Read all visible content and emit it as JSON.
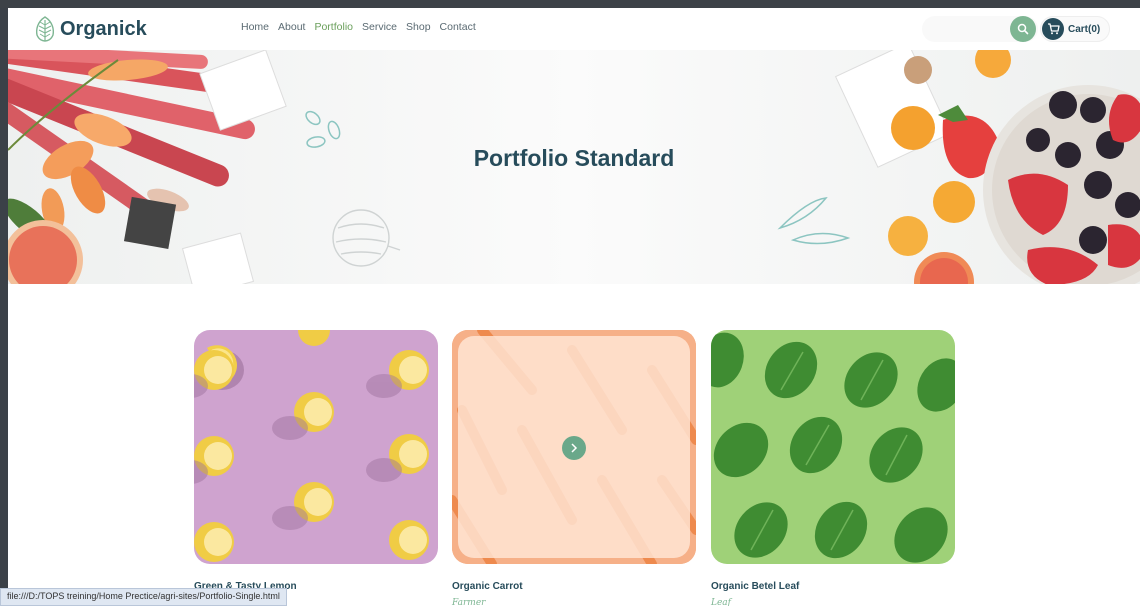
{
  "header": {
    "logo_text": "Organick",
    "nav": [
      {
        "label": "Home",
        "active": false
      },
      {
        "label": "About",
        "active": false
      },
      {
        "label": "Portfolio",
        "active": true
      },
      {
        "label": "Service",
        "active": false
      },
      {
        "label": "Shop",
        "active": false
      },
      {
        "label": "Contact",
        "active": false
      }
    ],
    "cart_label": "Cart(0)"
  },
  "banner": {
    "title": "Portfolio Standard"
  },
  "portfolio": [
    {
      "title": "Green & Tasty Lemon",
      "subtitle": "",
      "theme": "lemon"
    },
    {
      "title": "Organic Carrot",
      "subtitle": "Farmer",
      "theme": "carrot"
    },
    {
      "title": "Organic Betel Leaf",
      "subtitle": "Leaf",
      "theme": "leaf"
    }
  ],
  "status_bar": {
    "url": "file:///D:/TOPS treining/Home Prectice/agri-sites/Portfolio-Single.html"
  },
  "colors": {
    "primary": "#274c5b",
    "accent": "#7eb693",
    "active_nav": "#6a9f5b"
  }
}
